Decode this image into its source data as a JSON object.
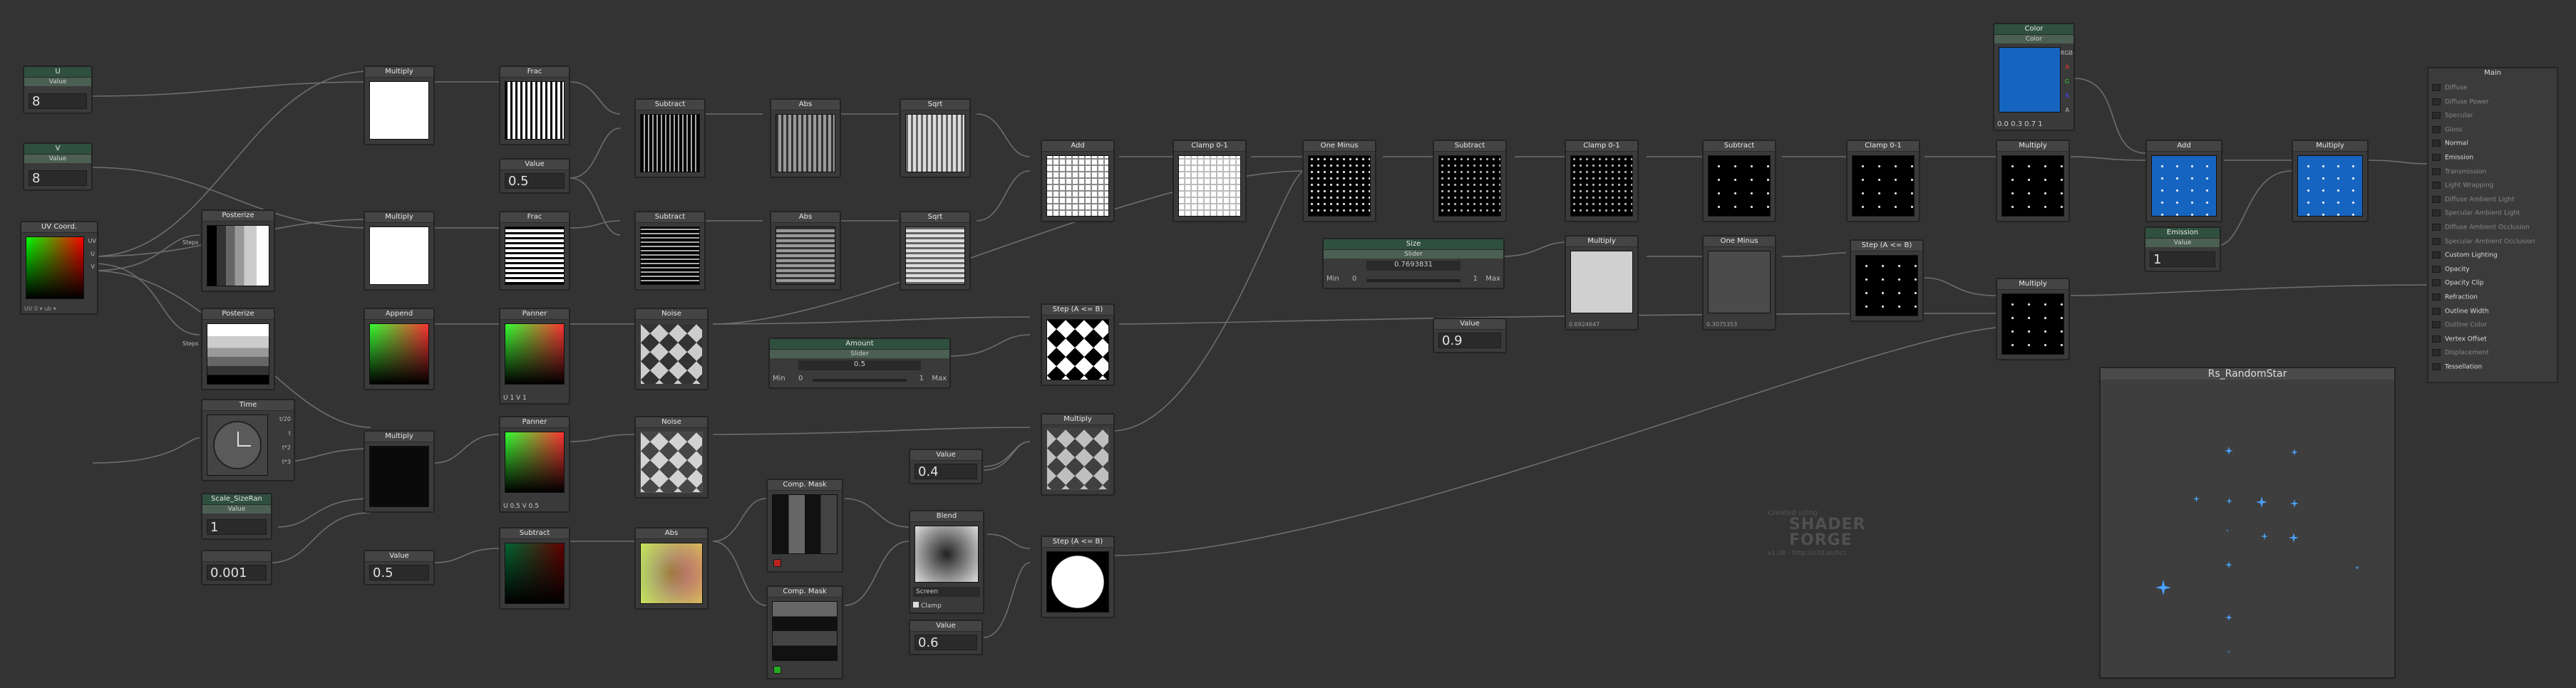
{
  "app": {
    "name": "Shader Forge",
    "preview_title": "Rs_RandomStar"
  },
  "watermark": {
    "line1": "Created using",
    "brand": "SHADER FORGE",
    "version": "v1.36 - http://u3d.as/6cc"
  },
  "nodes": {
    "u": {
      "title": "U",
      "sub": "Value",
      "value": "8"
    },
    "v": {
      "title": "V",
      "sub": "Value",
      "value": "8"
    },
    "uvcoord": {
      "title": "UV Coord.",
      "ports": [
        "UV",
        "U",
        "V"
      ],
      "footer": "UV 0 ▾ ub ▾"
    },
    "mul1": {
      "title": "Multiply"
    },
    "mul2": {
      "title": "Multiply"
    },
    "frac1": {
      "title": "Frac"
    },
    "frac2": {
      "title": "Frac"
    },
    "half": {
      "title": "Value",
      "value": "0.5"
    },
    "sub1": {
      "title": "Subtract"
    },
    "sub2": {
      "title": "Subtract"
    },
    "abs1": {
      "title": "Abs"
    },
    "abs2": {
      "title": "Abs"
    },
    "sqrt1": {
      "title": "Sqrt"
    },
    "sqrt2": {
      "title": "Sqrt"
    },
    "add1": {
      "title": "Add"
    },
    "clamp1": {
      "title": "Clamp 0-1"
    },
    "onemin1": {
      "title": "One Minus"
    },
    "sub3": {
      "title": "Subtract"
    },
    "clamp2": {
      "title": "Clamp 0-1"
    },
    "sub4": {
      "title": "Subtract"
    },
    "clamp3": {
      "title": "Clamp 0-1"
    },
    "mul3": {
      "title": "Multiply"
    },
    "color": {
      "title": "Color",
      "sub": "Color",
      "ports": [
        "RGB",
        "R",
        "G",
        "B",
        "A"
      ],
      "footer": "0.0  0.3  0.7  1"
    },
    "add2": {
      "title": "Add"
    },
    "mul4": {
      "title": "Multiply"
    },
    "emission": {
      "title": "Emission",
      "sub": "Value",
      "value": "1"
    },
    "post1": {
      "title": "Posterize",
      "port": "Steps"
    },
    "post2": {
      "title": "Posterize",
      "port": "Steps"
    },
    "append": {
      "title": "Append"
    },
    "panner1": {
      "title": "Panner",
      "footer": "U 1      V 1"
    },
    "panner2": {
      "title": "Panner",
      "footer": "U 0.5    V 0.5"
    },
    "noise1": {
      "title": "Noise"
    },
    "noise2": {
      "title": "Noise"
    },
    "amount": {
      "title": "Amount",
      "sub": "Slider",
      "value": "0.5",
      "min_label": "Min",
      "min": "0",
      "max": "1",
      "max_label": "Max"
    },
    "step1": {
      "title": "Step (A <= B)"
    },
    "step2": {
      "title": "Step (A <= B)"
    },
    "step3": {
      "title": "Step (A <= B)"
    },
    "size": {
      "title": "Size",
      "sub": "Slider",
      "value": "0.7693831",
      "min_label": "Min",
      "min": "0",
      "max": "1",
      "max_label": "Max"
    },
    "mul5": {
      "title": "Multiply",
      "footer": "0.6924647"
    },
    "onemin2": {
      "title": "One Minus",
      "footer": "0.3075353"
    },
    "val09": {
      "title": "Value",
      "value": "0.9"
    },
    "mul6": {
      "title": "Multiply"
    },
    "mul7": {
      "title": "Multiply"
    },
    "time": {
      "title": "Time",
      "ports": [
        "t/20",
        "t",
        "t*2",
        "t*3"
      ]
    },
    "scale": {
      "title": "Scale_SizeRan",
      "sub": "Value",
      "value": "1"
    },
    "val0001": {
      "title": "",
      "value": "0.001"
    },
    "mul8": {
      "title": "Multiply"
    },
    "val05b": {
      "title": "Value",
      "value": "0.5"
    },
    "sub5": {
      "title": "Subtract"
    },
    "abs3": {
      "title": "Abs"
    },
    "mask1": {
      "title": "Comp. Mask"
    },
    "mask2": {
      "title": "Comp. Mask"
    },
    "blend": {
      "title": "Blend",
      "mode": "Screen",
      "clamp": "Clamp"
    },
    "val04": {
      "title": "Value",
      "value": "0.4"
    },
    "val06": {
      "title": "Value",
      "value": "0.6"
    }
  },
  "main": {
    "title": "Main",
    "inputs": [
      {
        "label": "Diffuse",
        "on": false
      },
      {
        "label": "Diffuse Power",
        "on": false
      },
      {
        "label": "Specular",
        "on": false
      },
      {
        "label": "Gloss",
        "on": false
      },
      {
        "label": "Normal",
        "on": true
      },
      {
        "label": "Emission",
        "on": true
      },
      {
        "label": "Transmission",
        "on": false
      },
      {
        "label": "Light Wrapping",
        "on": false
      },
      {
        "label": "Diffuse Ambient Light",
        "on": false
      },
      {
        "label": "Specular Ambient Light",
        "on": false
      },
      {
        "label": "Diffuse Ambient Occlusion",
        "on": false
      },
      {
        "label": "Specular Ambient Occlusion",
        "on": false
      },
      {
        "label": "Custom Lighting",
        "on": true
      },
      {
        "label": "Opacity",
        "on": true
      },
      {
        "label": "Opacity Clip",
        "on": true
      },
      {
        "label": "Refraction",
        "on": true
      },
      {
        "label": "Outline Width",
        "on": true
      },
      {
        "label": "Outline Color",
        "on": false
      },
      {
        "label": "Vertex Offset",
        "on": true
      },
      {
        "label": "Displacement",
        "on": false
      },
      {
        "label": "Tessellation",
        "on": true
      }
    ]
  },
  "colors": {
    "bg": "#333333",
    "accent_blue": "#1565c0",
    "node_green": "#2f4f3f"
  }
}
